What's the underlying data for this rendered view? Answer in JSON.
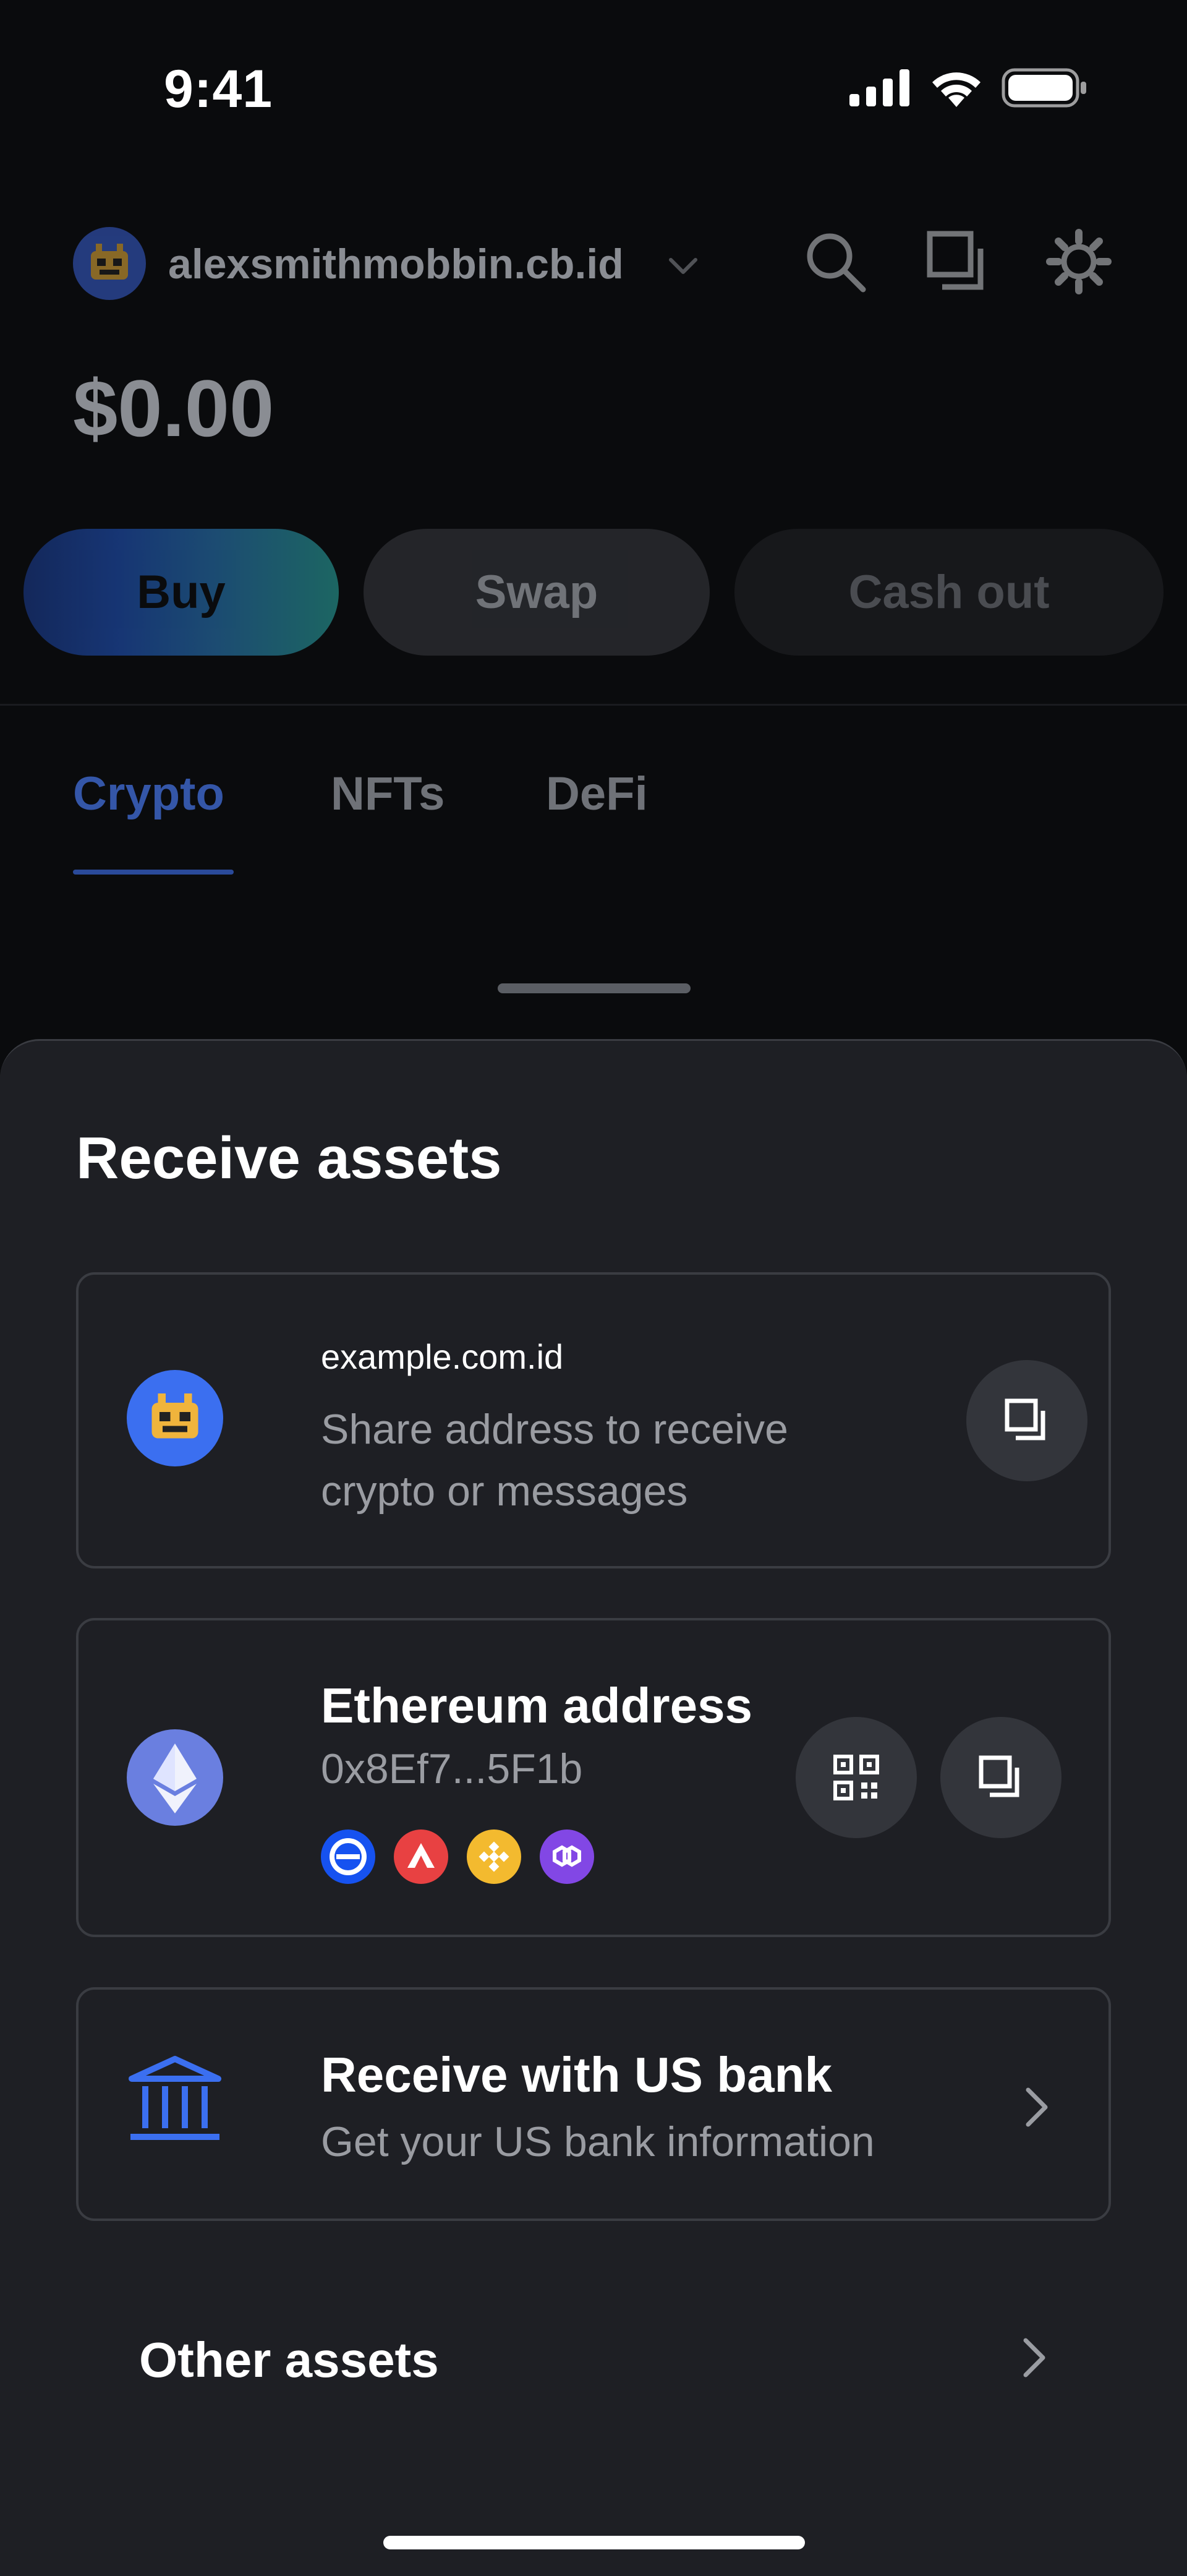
{
  "status_bar": {
    "time": "9:41"
  },
  "header": {
    "account_name": "alexsmithmobbin.cb.id",
    "balance": "$0.00"
  },
  "actions": {
    "buy": "Buy",
    "swap": "Swap",
    "cash_out": "Cash out"
  },
  "tabs": [
    {
      "label": "Crypto",
      "active": true
    },
    {
      "label": "NFTs",
      "active": false
    },
    {
      "label": "DeFi",
      "active": false
    }
  ],
  "sheet": {
    "title": "Receive assets",
    "cards": [
      {
        "label": "example.com.id",
        "description_line1": "Share address to receive",
        "description_line2": "crypto or messages"
      },
      {
        "title": "Ethereum address",
        "address": "0x8Ef7...5F1b",
        "chain_icons": [
          "base-icon",
          "avalanche-icon",
          "bnb-icon",
          "polygon-icon"
        ]
      },
      {
        "title": "Receive with US bank",
        "description": "Get your US bank information"
      }
    ],
    "other_assets": "Other assets"
  },
  "colors": {
    "accent": "#3b63d9",
    "background": "#0a0b0d",
    "sheet": "#1e1f24"
  }
}
